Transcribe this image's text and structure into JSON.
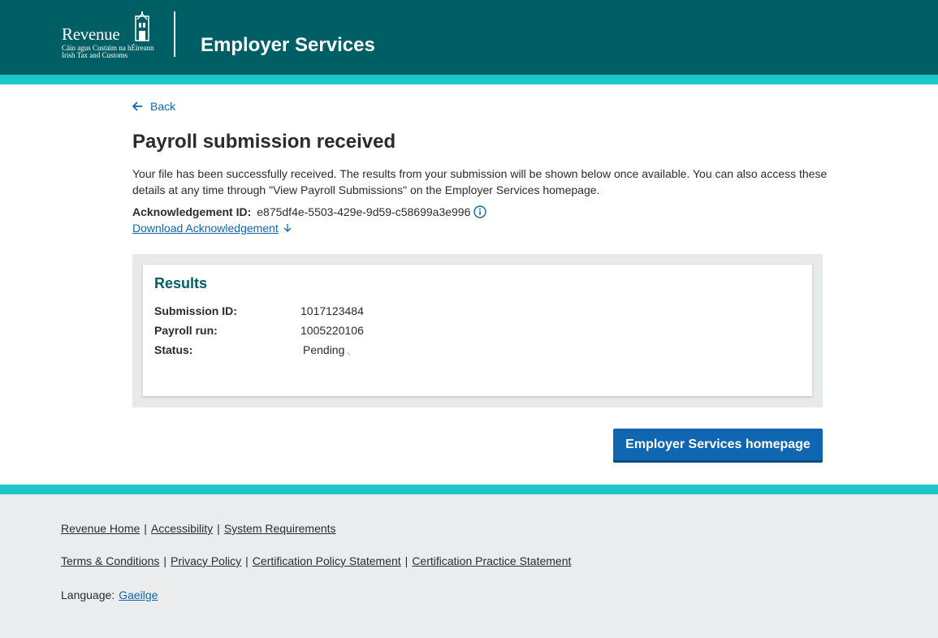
{
  "header": {
    "logo": {
      "word": "Revenue",
      "sub1": "Cáin agus Custaim na hÉireann",
      "sub2": "Irish Tax and Customs"
    },
    "title": "Employer Services"
  },
  "colors": {
    "header_bg": "#005f65",
    "accent_stripe": "#1cc7c7",
    "link": "#1066b0",
    "button": "#1066b0",
    "footer_bg": "#ebecee"
  },
  "main": {
    "back_label": "Back",
    "title": "Payroll submission received",
    "intro": "Your file has been successfully received. The results from your submission will be shown below once available. You can also access these details at any time through \"View Payroll Submissions\" on the Employer Services homepage.",
    "ack_label": "Acknowledgement ID:",
    "ack_value": "e875df4e-5503-429e-9d59-c58699a3e996",
    "download_label": "Download Acknowledgement",
    "results": {
      "title": "Results",
      "rows": [
        {
          "label": "Submission ID:",
          "value": "1017123484"
        },
        {
          "label": "Payroll run:",
          "value": "1005220106"
        },
        {
          "label": "Status:",
          "value": "Pending"
        }
      ]
    },
    "home_button": "Employer Services homepage"
  },
  "footer": {
    "row1": [
      "Revenue Home",
      "Accessibility",
      "System Requirements"
    ],
    "row2": [
      "Terms & Conditions",
      "Privacy Policy",
      "Certification Policy Statement",
      "Certification Practice Statement"
    ],
    "language_label": "Language:",
    "language_link": "Gaeilge",
    "separator": "|"
  }
}
